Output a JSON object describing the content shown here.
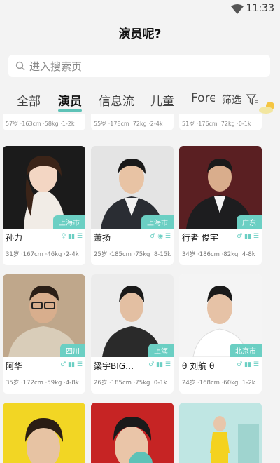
{
  "status": {
    "time": "11:33"
  },
  "title": "演员呢?",
  "search": {
    "placeholder": "进入搜索页"
  },
  "tabs": [
    "全部",
    "演员",
    "信息流",
    "儿童",
    "Fore"
  ],
  "filter": {
    "label": "筛选"
  },
  "row0_meta": [
    "57岁 ·163cm ·58kg ·1-2k",
    "55岁 ·178cm ·72kg ·2-4k",
    "51岁 ·176cm ·72kg ·0-1k"
  ],
  "cards": [
    {
      "name": "孙力",
      "location": "上海市",
      "meta": "31岁 ·167cm ·46kg ·2-4k",
      "badges": "♀ ▮▮ ☰"
    },
    {
      "name": "萧扬",
      "location": "上海市",
      "meta": "25岁 ·185cm ·75kg ·8-15k",
      "badges": "♂ ◉ ☰"
    },
    {
      "name": "行者 俊宇",
      "location": "广东",
      "meta": "34岁 ·186cm ·82kg ·4-8k",
      "badges": "♂ ▮▮ ☰"
    },
    {
      "name": "阿华",
      "location": "四川",
      "meta": "35岁 ·172cm ·59kg ·4-8k",
      "badges": "♂ ▮▮ ☰"
    },
    {
      "name": "梁宇BIG…",
      "location": "上海",
      "meta": "26岁 ·185cm ·75kg ·0-1k",
      "badges": "♂ ▮▮ ☰"
    },
    {
      "name": "θ 刘航 θ",
      "location": "北京市",
      "meta": "24岁 ·168cm ·60kg ·1-2k",
      "badges": "♂ ▮▮ ☰"
    }
  ],
  "colors": {
    "accent": "#5ec2b7",
    "badge": "#6bcfc3"
  }
}
